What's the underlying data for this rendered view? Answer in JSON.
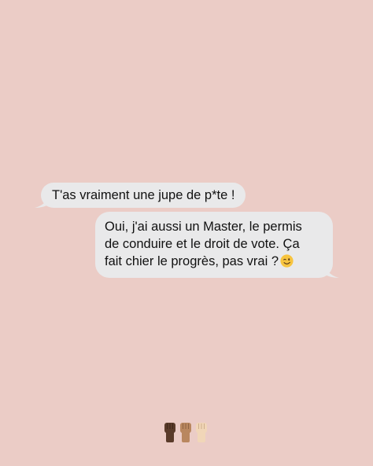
{
  "messages": [
    {
      "direction": "incoming",
      "text": "T'as vraiment une jupe de p*te !"
    },
    {
      "direction": "outgoing",
      "lines": [
        "Oui, j'ai aussi un Master, le permis",
        "de conduire et le droit de vote. Ça",
        "fait chier le progrès, pas vrai ?"
      ],
      "emoji": "winking-face-emoji"
    }
  ],
  "footer": {
    "icons": [
      "raised-fist-dark-icon",
      "raised-fist-medium-icon",
      "raised-fist-light-icon"
    ],
    "colors": [
      "#5a3b2a",
      "#b9875f",
      "#f1d6b8"
    ]
  },
  "colors": {
    "background": "#ebccc6",
    "bubble": "#e9e9ea",
    "text": "#111111"
  }
}
